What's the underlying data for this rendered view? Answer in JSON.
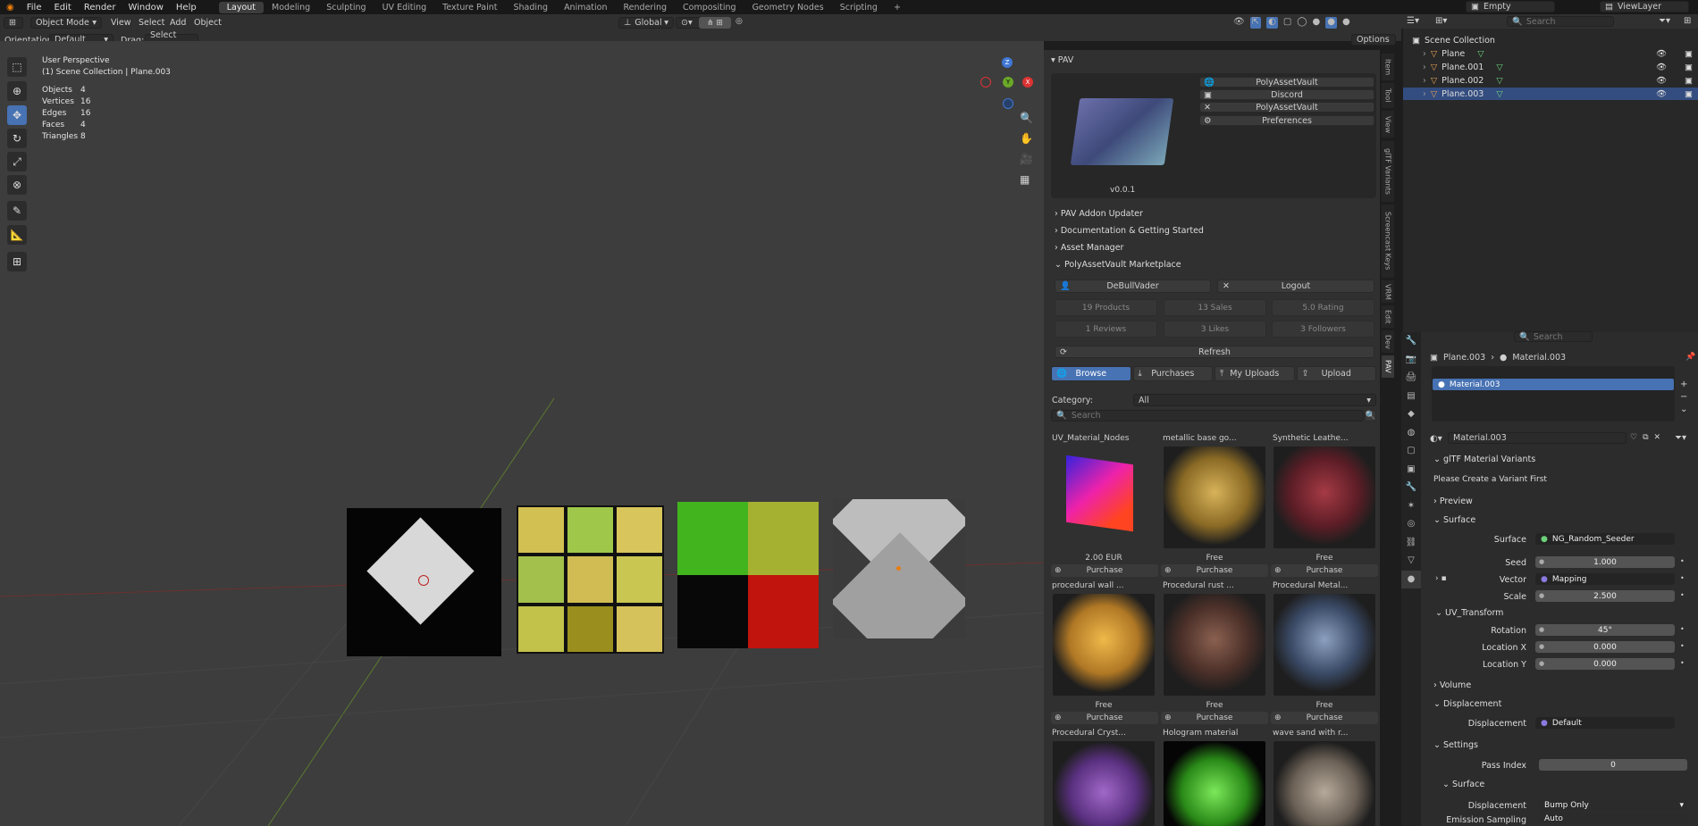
{
  "menu": [
    "File",
    "Edit",
    "Render",
    "Window",
    "Help"
  ],
  "workspaces": [
    "Layout",
    "Modeling",
    "Sculpting",
    "UV Editing",
    "Texture Paint",
    "Shading",
    "Animation",
    "Rendering",
    "Compositing",
    "Geometry Nodes",
    "Scripting"
  ],
  "add_workspace": "+",
  "scene": {
    "name": "Empty",
    "view_layer": "ViewLayer"
  },
  "header": {
    "mode": "Object Mode",
    "view_menu": [
      "View",
      "Select",
      "Add",
      "Object"
    ],
    "transform": "Global",
    "orientation_label": "Orientation:",
    "orientation_value": "Default",
    "drag_label": "Drag:",
    "drag_value": "Select Box",
    "options": "Options"
  },
  "overlay": {
    "perspective": "User Perspective",
    "collection": "(1) Scene Collection | Plane.003",
    "stats": [
      {
        "label": "Objects",
        "value": "4"
      },
      {
        "label": "Vertices",
        "value": "16"
      },
      {
        "label": "Edges",
        "value": "16"
      },
      {
        "label": "Faces",
        "value": "4"
      },
      {
        "label": "Triangles",
        "value": "8"
      }
    ]
  },
  "gizmo": {
    "z": "Z",
    "y": "Y",
    "x": "X"
  },
  "pav": {
    "title": "PAV",
    "version": "v0.0.1",
    "links": [
      "PolyAssetVault",
      "Discord",
      "PolyAssetVault",
      "Preferences"
    ],
    "sections": [
      "PAV Addon Updater",
      "Documentation & Getting Started",
      "Asset Manager",
      "PolyAssetVault Marketplace"
    ],
    "user": "DeBullVader",
    "logout": "Logout",
    "stats": [
      "19 Products",
      "13 Sales",
      "5.0 Rating",
      "1 Reviews",
      "3 Likes",
      "3 Followers"
    ],
    "refresh": "Refresh",
    "tabs": [
      "Browse",
      "Purchases",
      "My Uploads",
      "Upload"
    ],
    "category_label": "Category:",
    "category_value": "All",
    "search_placeholder": "Search",
    "products": [
      {
        "title": "UV_Material_Nodes",
        "price": "2.00 EUR",
        "btn": "Purchase"
      },
      {
        "title": "metallic base go...",
        "price": "Free",
        "btn": "Purchase"
      },
      {
        "title": "Synthetic Leathe...",
        "price": "Free",
        "btn": "Purchase"
      },
      {
        "title": "procedural wall ...",
        "price": "Free",
        "btn": "Purchase"
      },
      {
        "title": "Procedural rust ...",
        "price": "Free",
        "btn": "Purchase"
      },
      {
        "title": "Procedural Metal...",
        "price": "Free",
        "btn": "Purchase"
      },
      {
        "title": "Procedural Cryst...",
        "price": "",
        "btn": ""
      },
      {
        "title": "Hologram material",
        "price": "",
        "btn": ""
      },
      {
        "title": "wave sand with r...",
        "price": "",
        "btn": ""
      }
    ]
  },
  "side_tabs": [
    "Item",
    "Tool",
    "View",
    "glTF Variants",
    "Screencast Keys",
    "VRM",
    "Edit",
    "Dev",
    "PAV"
  ],
  "outliner": {
    "search_placeholder": "Search",
    "root": "Scene Collection",
    "items": [
      "Plane",
      "Plane.001",
      "Plane.002",
      "Plane.003"
    ]
  },
  "properties": {
    "search_placeholder": "Search",
    "breadcrumb_object": "Plane.003",
    "breadcrumb_material": "Material.003",
    "slot": "Material.003",
    "material_name": "Material.003",
    "gltf_title": "glTF Material Variants",
    "gltf_note": "Please Create a Variant First",
    "preview": "Preview",
    "surface_title": "Surface",
    "rows": [
      {
        "label": "Surface",
        "value": "NG_Random_Seeder"
      },
      {
        "label": "Seed",
        "value": "1.000"
      },
      {
        "label": "Vector",
        "value": "Mapping"
      },
      {
        "label": "Scale",
        "value": "2.500"
      }
    ],
    "uv_transform": "UV_Transform",
    "uv_rows": [
      {
        "label": "Rotation",
        "value": "45°"
      },
      {
        "label": "Location X",
        "value": "0.000"
      },
      {
        "label": "Location Y",
        "value": "0.000"
      }
    ],
    "volume": "Volume",
    "displacement_title": "Displacement",
    "displacement_label": "Displacement",
    "displacement_value": "Default",
    "settings": "Settings",
    "pass_index_label": "Pass Index",
    "pass_index_value": "0",
    "sub_surface": "Surface",
    "disp_method_label": "Displacement",
    "disp_method_value": "Bump Only",
    "emission_label": "Emission Sampling",
    "emission_value": "Auto"
  }
}
